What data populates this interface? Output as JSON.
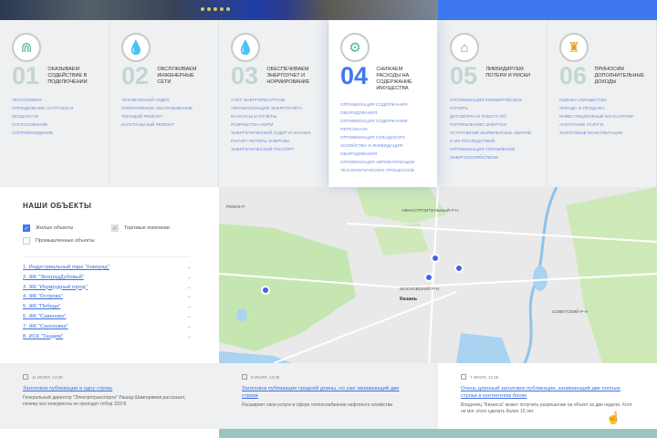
{
  "hero": {
    "slides": 5,
    "accent": "#3d78f0"
  },
  "services": [
    {
      "num": "01",
      "icon": "pipe-icon",
      "title": "Оказываем содействие в подключении",
      "links": [
        "Техусловия",
        "Определение нагрузок и мощности",
        "Согласование",
        "Сопровождение"
      ]
    },
    {
      "num": "02",
      "icon": "drop-icon",
      "title": "Обслуживаем инженерные сети",
      "links": [
        "Технический аудит",
        "Оперативное обслуживание",
        "Текущий ремонт",
        "Капитальный ремонт"
      ]
    },
    {
      "num": "03",
      "icon": "drop-icon",
      "title": "Обеспечиваем энергоучет и нормирование",
      "links": [
        "Учёт энергоресурсов",
        "Автоматизация энергоучёта",
        "Балансы и отчёты",
        "Разработка норм",
        "Энергетический аудит и анализ",
        "Расчёт потерь энергии",
        "Энергетический паспорт"
      ]
    },
    {
      "num": "04",
      "icon": "gears-icon",
      "title": "Снижаем расходы на содержание имущества",
      "links": [
        "Оптимизация содержания оборудования",
        "Оптимизация содержания персонала",
        "Оптимизация складского хозяйства и ликвидация оборудования",
        "Оптимизация автоматизации технологических процессов"
      ]
    },
    {
      "num": "05",
      "icon": "house-icon",
      "title": "Ликвидируем потери и риски",
      "links": [
        "Оптимизация коммерческих потерь",
        "Договорная работа по потреблению энергии",
        "Устранение выявленных аварий и их последствий",
        "Оптимизация управления энергохозяйством"
      ]
    },
    {
      "num": "06",
      "icon": "hydrant-icon",
      "title": "Приносим дополнительные доходы",
      "links": [
        "Оценка имущества",
        "Аренда и продажа",
        "Инвестиционный консалтинг",
        "Агентские услуги",
        "Залоговые консультации"
      ]
    }
  ],
  "objects": {
    "title": "Наши объекты",
    "filters": [
      {
        "label": "Жилые объекты",
        "checked": true
      },
      {
        "label": "Торговые компании",
        "checked": true
      },
      {
        "label": "Промышленные объекты",
        "checked": false
      }
    ],
    "items": [
      "1. Индустриальный парк \"Химград\"",
      "2. ЖК \"ЭкоградДубовый\"",
      "3. ЖК \"Изумрудный город\"",
      "4. ЖК \"Острова\"",
      "5. ЖК \"Победа\"",
      "6. ЖК \"Савиново\"",
      "7. ЖК \"Соколовка\"",
      "8. ИСК \"Тандем\""
    ],
    "arrow": "→"
  },
  "map": {
    "labels": {
      "city": "Казань",
      "district1": "Московский р-н",
      "district2": "Авиастроительный р-н",
      "district3": "Советский р-н",
      "village": "Ремонт"
    },
    "pins": 4
  },
  "news": [
    {
      "date": "11 июля, 13:36",
      "title": "Заголовок публикации в одну строку",
      "text": "Генеральный директор \"Электротранспорта\" Рашид Шамгаримов рассказал, почему все конкуренты не проходят отбор ЗЗЗ Б"
    },
    {
      "date": "8 июля, 13:36",
      "title": "Заголовок публикации средней длины, но уже занимающий две строки",
      "text": "Расширяет свои услуги в сфере теплоснабжения нефтяного хозяйства"
    },
    {
      "date": "7 июля, 13:36",
      "title": "Очень длинный заголовок публикации, занимающий две полные строки в контентном блоке",
      "text": "Владелец \"Бизнеса\" может получить разрешение на объект за две недели. Хотя не мог этого сделать более 10 лет."
    }
  ]
}
